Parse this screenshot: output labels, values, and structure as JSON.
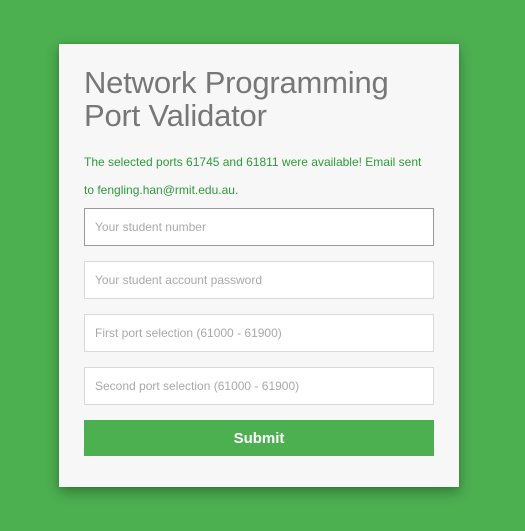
{
  "form": {
    "title_line1": "Network Programming",
    "title_line2": "Port Validator",
    "message": "The selected ports 61745 and 61811 were available! Email sent to fengling.han@rmit.edu.au.",
    "fields": [
      {
        "placeholder": "Your student number",
        "value": ""
      },
      {
        "placeholder": "Your student account password",
        "value": ""
      },
      {
        "placeholder": "First port selection (61000 - 61900)",
        "value": ""
      },
      {
        "placeholder": "Second port selection (61000 - 61900)",
        "value": ""
      }
    ],
    "submit_label": "Submit"
  },
  "colors": {
    "background": "#4caf50",
    "card": "#f7f7f7",
    "title": "#777777",
    "message": "#2e9c3a",
    "button": "#4caf50",
    "button_text": "#ffffff"
  }
}
